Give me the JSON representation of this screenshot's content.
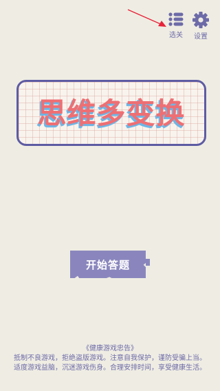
{
  "header": {
    "levels_label": "选关",
    "settings_label": "设置"
  },
  "title": "思维多变换",
  "start_button_label": "开始答题",
  "health_advice": {
    "title": "《健康游戏忠告》",
    "line1": "抵制不良游戏，拒绝盗版游戏。注意自我保护，谨防受骗上当。",
    "line2": "适度游戏益脑，沉迷游戏伤身。合理安排时间，享受健康生活。"
  },
  "colors": {
    "background": "#efede3",
    "accent_purple": "#6d6aa8",
    "title_red": "#ee6f73",
    "title_shadow_blue": "#6db6e6",
    "button_purple": "#8a86bd",
    "annotation_arrow": "#e8233a"
  }
}
